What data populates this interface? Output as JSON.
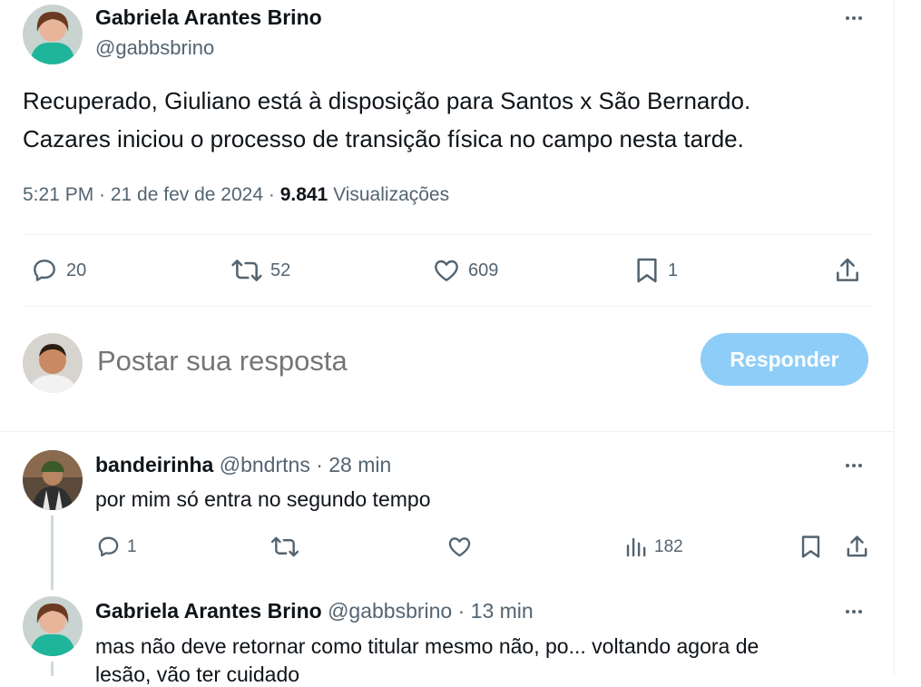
{
  "main_tweet": {
    "author_name": "Gabriela Arantes Brino",
    "handle": "@gabbsbrino",
    "text_line1": "Recuperado, Giuliano está à disposição para Santos x São Bernardo.",
    "text_line2": "Cazares iniciou o processo de transição física no campo nesta tarde.",
    "time": "5:21 PM · 21 de fev de 2024 · ",
    "views_count": "9.841",
    "views_label": " Visualizações",
    "replies": "20",
    "retweets": "52",
    "likes": "609",
    "bookmarks": "1"
  },
  "composer": {
    "placeholder": "Postar sua resposta",
    "reply_button": "Responder"
  },
  "replies": [
    {
      "name": "bandeirinha",
      "handle": "@bndrtns",
      "time": " · 28 min",
      "text": "por mim só entra no segundo tempo",
      "replies": "1",
      "views": "182"
    },
    {
      "name": "Gabriela Arantes Brino",
      "handle": "@gabbsbrino",
      "time": " · 13 min",
      "text_line1": "mas não deve retornar como titular mesmo não, po... voltando agora de",
      "text_line2": "lesão, vão ter cuidado"
    }
  ],
  "colors": {
    "accent_disabled": "#8ecdf7",
    "muted_text": "#536471",
    "divider": "#eff3f4"
  },
  "icons": [
    "more-icon",
    "reply-icon",
    "retweet-icon",
    "like-icon",
    "bookmark-icon",
    "share-icon",
    "views-icon"
  ]
}
